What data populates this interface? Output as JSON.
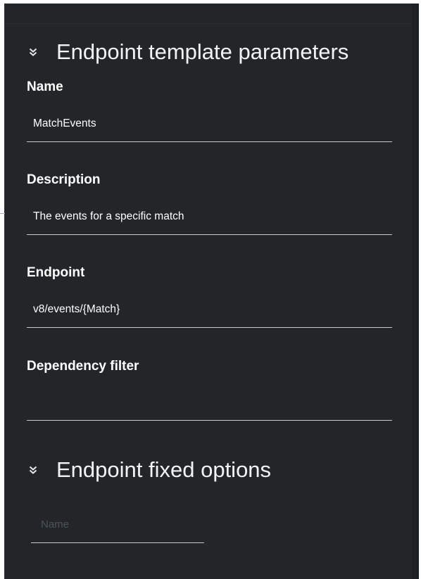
{
  "sections": {
    "template_params": {
      "title": "Endpoint template parameters",
      "chevron_icon": "double-chevron-down-icon"
    },
    "fixed_options": {
      "title": "Endpoint fixed options",
      "chevron_icon": "double-chevron-down-icon"
    }
  },
  "fields": {
    "name": {
      "label": "Name",
      "value": "MatchEvents"
    },
    "description": {
      "label": "Description",
      "value": "The events for a specific match"
    },
    "endpoint": {
      "label": "Endpoint",
      "value": "v8/events/{Match}"
    },
    "dependency_filter": {
      "label": "Dependency filter",
      "value": ""
    }
  },
  "fixed_options": {
    "name_input": {
      "placeholder": "Name",
      "value": ""
    }
  },
  "colors": {
    "panel_bg": "#232629",
    "text": "#ffffff",
    "underline": "#c6c9cc",
    "placeholder": "#4d5358"
  }
}
